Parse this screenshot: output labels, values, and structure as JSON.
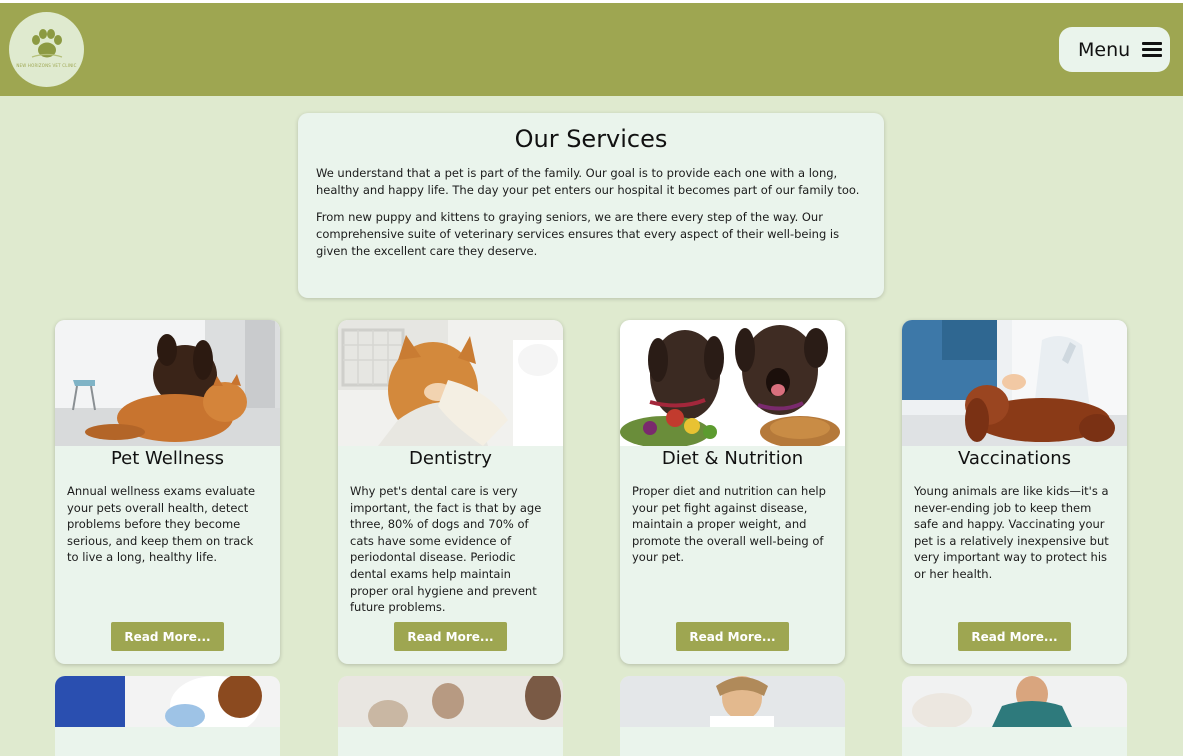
{
  "header": {
    "logo_text": "NEW HORIZONS VET CLINIC",
    "menu_label": "Menu",
    "bar_color": "#9ea651",
    "background_color": "#dfeacf"
  },
  "intro": {
    "title": "Our Services",
    "paragraph_1": "We understand that a pet is part of the family. Our goal is to provide each one with a long, healthy and happy life. The day your pet enters our hospital it becomes part of our family too.",
    "paragraph_2": "From new puppy and kittens to graying seniors, we are there every step of the way. Our comprehensive suite of veterinary services ensures that every aspect of their well-being is given the excellent care they deserve."
  },
  "services": [
    {
      "title": "Pet Wellness",
      "description": "Annual wellness exams evaluate your pets overall health, detect problems before they become serious, and keep them on track to live a long, healthy life.",
      "button_label": "Read More...",
      "image": "dog-and-cat-photo"
    },
    {
      "title": "Dentistry",
      "description": "Why pet's dental care is very important, the fact is that by age three, 80% of dogs and 70% of cats have some evidence of periodontal disease. Periodic dental exams help maintain proper oral hygiene and prevent future problems.",
      "button_label": "Read More...",
      "image": "cat-dental-exam-photo"
    },
    {
      "title": "Diet & Nutrition",
      "description": "Proper diet and nutrition can help your pet fight against disease, maintain a proper weight, and promote the overall well-being of your pet.",
      "button_label": "Read More...",
      "image": "labradors-with-food-photo"
    },
    {
      "title": "Vaccinations",
      "description": "Young animals are like kids—it's a never-ending job to keep them safe and happy. Vaccinating your pet is a relatively inexpensive but very important way to protect his or her health.",
      "button_label": "Read More...",
      "image": "spaniel-at-vet-photo"
    }
  ],
  "accent_color": "#9ea651",
  "card_color": "#eaf4ec"
}
